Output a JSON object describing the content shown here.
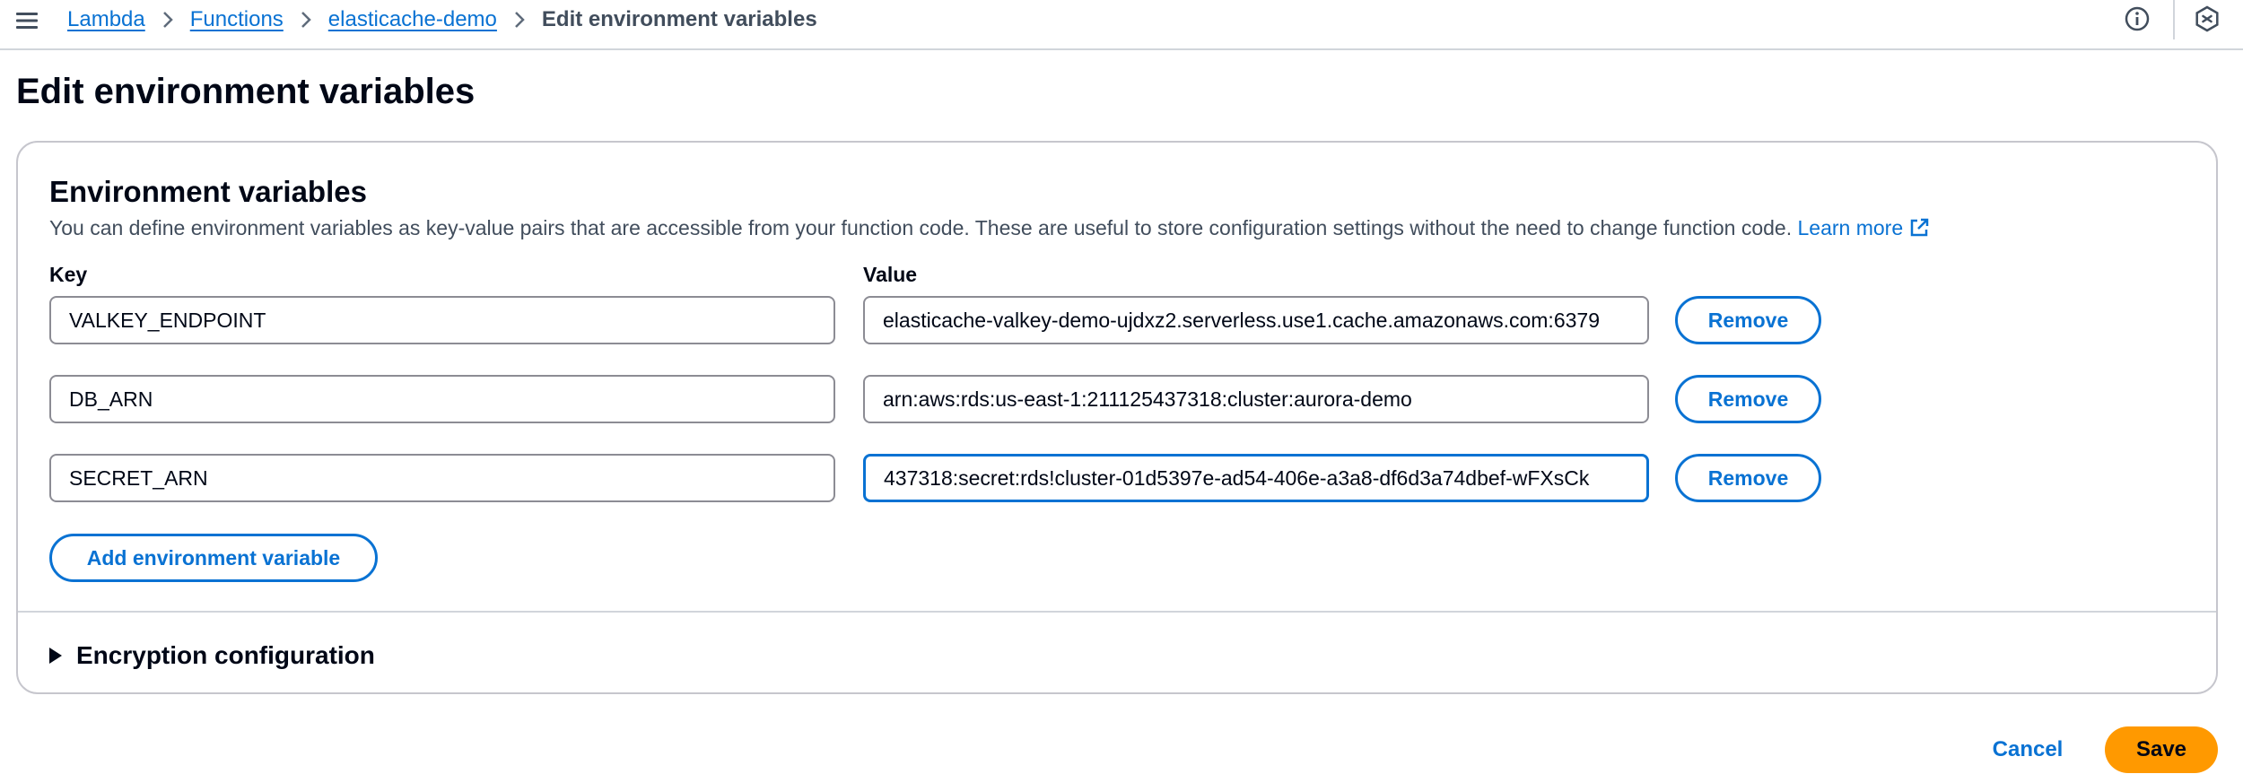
{
  "breadcrumb": {
    "items": [
      "Lambda",
      "Functions",
      "elasticache-demo"
    ],
    "current": "Edit environment variables"
  },
  "page": {
    "title": "Edit environment variables"
  },
  "env_section": {
    "title": "Environment variables",
    "description": "You can define environment variables as key-value pairs that are accessible from your function code. These are useful to store configuration settings without the need to change function code.",
    "learn_more": "Learn more",
    "key_label": "Key",
    "value_label": "Value",
    "variables": [
      {
        "key": "VALKEY_ENDPOINT",
        "value": "elasticache-valkey-demo-ujdxz2.serverless.use1.cache.amazonaws.com:6379"
      },
      {
        "key": "DB_ARN",
        "value": "arn:aws:rds:us-east-1:211125437318:cluster:aurora-demo"
      },
      {
        "key": "SECRET_ARN",
        "value": "437318:secret:rds!cluster-01d5397e-ad54-406e-a3a8-df6d3a74dbef-wFXsCk"
      }
    ],
    "remove_label": "Remove",
    "add_label": "Add environment variable",
    "encryption_label": "Encryption configuration"
  },
  "footer": {
    "cancel_label": "Cancel",
    "save_label": "Save"
  },
  "colors": {
    "link": "#0972d3",
    "primary_button": "#ff9900",
    "border": "#8c8c94"
  },
  "icons": {
    "menu": "hamburger-menu-icon",
    "separator": "chevron-right-icon",
    "info": "info-icon",
    "settings": "hexagon-settings-icon",
    "external": "external-link-icon",
    "expand": "caret-right-icon"
  }
}
